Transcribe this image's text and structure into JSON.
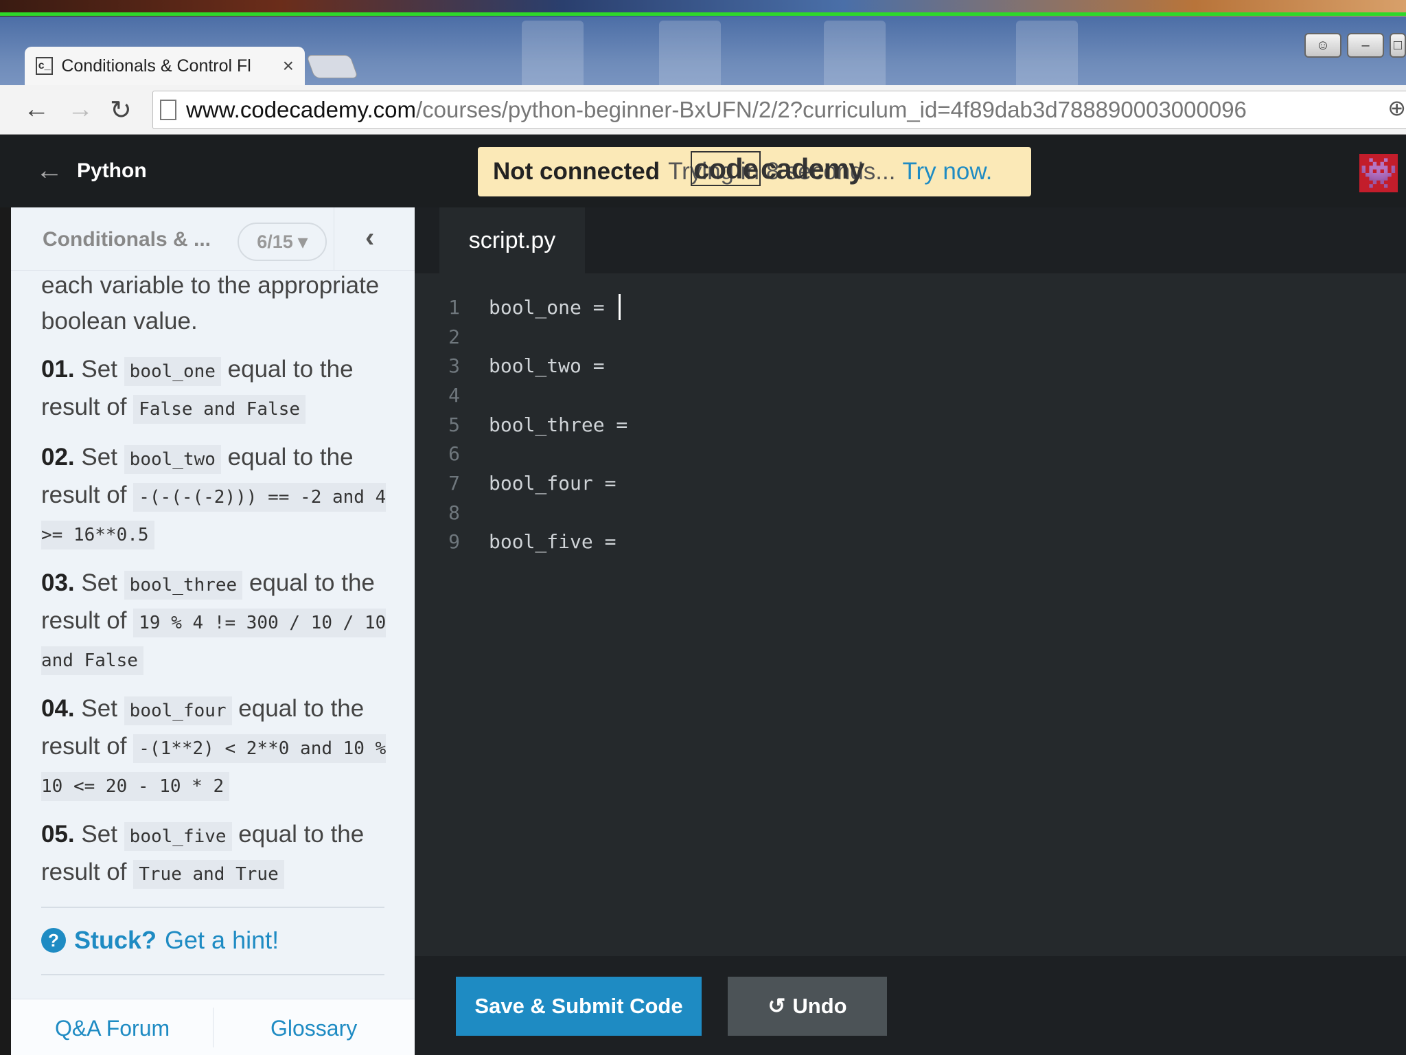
{
  "browser": {
    "tab_title": "Conditionals & Control Fl",
    "tab_favicon": "c_",
    "tab_close": "×",
    "url_domain": "www.codecademy.com",
    "url_path": "/courses/python-beginner-BxUFN/2/2?curriculum_id=4f89dab3d788890003000096"
  },
  "app": {
    "course_title": "Python",
    "banner": {
      "bold": "Not connected",
      "text": "Trying in 8 seconds...",
      "link": "Try now.",
      "logo": "codecademy"
    }
  },
  "sidebar": {
    "lesson_title": "Conditionals & ...",
    "progress": "6/15 ▾",
    "intro": "each variable to the appropriate boolean value.",
    "steps": [
      {
        "num": "01.",
        "pre": "Set",
        "var": "bool_one",
        "mid": "equal to the result of",
        "expr": "False and False"
      },
      {
        "num": "02.",
        "pre": "Set",
        "var": "bool_two",
        "mid": "equal to the result of",
        "expr": "-(-(-(-2))) == -2 and 4 >= 16**0.5"
      },
      {
        "num": "03.",
        "pre": "Set",
        "var": "bool_three",
        "mid": "equal to the result of",
        "expr": "19 % 4 != 300 / 10 / 10 and False"
      },
      {
        "num": "04.",
        "pre": "Set",
        "var": "bool_four",
        "mid": "equal to the result of",
        "expr": "-(1**2) < 2**0 and 10 % 10 <= 20 - 10 * 2"
      },
      {
        "num": "05.",
        "pre": "Set",
        "var": "bool_five",
        "mid": "equal to the result of",
        "expr": "True and True"
      }
    ],
    "hint_stuck": "Stuck?",
    "hint_link": "Get a hint!",
    "footer_qa": "Q&A Forum",
    "footer_glossary": "Glossary"
  },
  "editor": {
    "filename": "script.py",
    "lines": [
      {
        "n": "1",
        "code": "bool_one = "
      },
      {
        "n": "2",
        "code": ""
      },
      {
        "n": "3",
        "code": "bool_two = "
      },
      {
        "n": "4",
        "code": ""
      },
      {
        "n": "5",
        "code": "bool_three = "
      },
      {
        "n": "6",
        "code": ""
      },
      {
        "n": "7",
        "code": "bool_four = "
      },
      {
        "n": "8",
        "code": ""
      },
      {
        "n": "9",
        "code": "bool_five = "
      }
    ],
    "submit_label": "Save & Submit Code",
    "undo_label": "Undo"
  },
  "colors": {
    "accent": "#1e8bc3",
    "banner_bg": "#fbe9b7",
    "editor_bg": "#25292c",
    "header_bg": "#1b1e20"
  },
  "icons": [
    "back-arrow-icon",
    "forward-arrow-icon",
    "reload-icon",
    "page-icon",
    "zoom-icon",
    "chevron-left-icon",
    "help-circle-icon",
    "undo-icon",
    "avatar-icon"
  ]
}
